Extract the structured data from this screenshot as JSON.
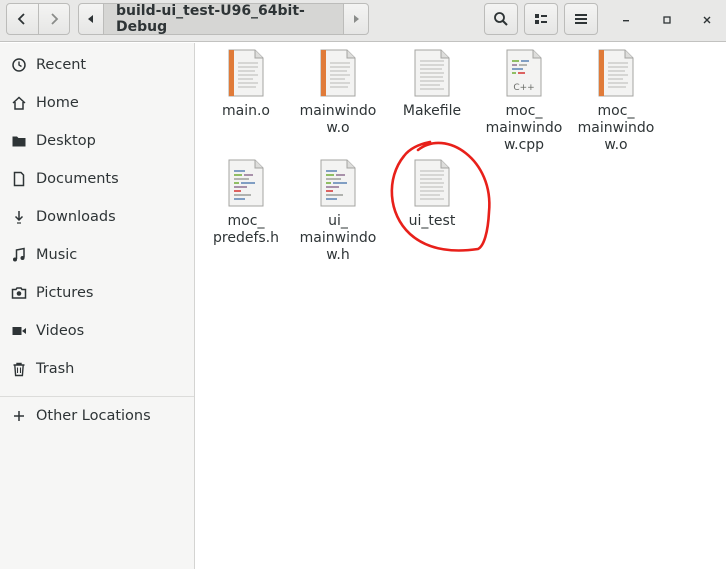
{
  "toolbar": {
    "back_icon": "chevron-left-icon",
    "forward_icon": "chevron-right-icon",
    "path_left_icon": "triangle-left-icon",
    "path_right_icon": "triangle-right-icon",
    "current_folder": "build-ui_test-U96_64bit-Debug",
    "search_icon": "search-icon",
    "view_icon": "view-options-icon",
    "menu_icon": "hamburger-menu-icon",
    "minimize_icon": "minimize-icon",
    "maximize_icon": "maximize-icon",
    "close_icon": "close-icon"
  },
  "sidebar": {
    "items": [
      {
        "label": "Recent",
        "icon": "clock-icon"
      },
      {
        "label": "Home",
        "icon": "home-icon"
      },
      {
        "label": "Desktop",
        "icon": "folder-icon"
      },
      {
        "label": "Documents",
        "icon": "document-icon"
      },
      {
        "label": "Downloads",
        "icon": "download-icon"
      },
      {
        "label": "Music",
        "icon": "music-icon"
      },
      {
        "label": "Pictures",
        "icon": "camera-icon"
      },
      {
        "label": "Videos",
        "icon": "video-icon"
      },
      {
        "label": "Trash",
        "icon": "trash-icon"
      }
    ],
    "other_locations": {
      "label": "Other Locations",
      "icon": "plus-icon"
    }
  },
  "files": [
    {
      "name": "main.o",
      "type": "object"
    },
    {
      "name": "mainwindow.o",
      "type": "object"
    },
    {
      "name": "Makefile",
      "type": "text"
    },
    {
      "name": "moc_mainwindow.cpp",
      "type": "cpp"
    },
    {
      "name": "moc_mainwindow.o",
      "type": "object"
    },
    {
      "name": "moc_predefs.h",
      "type": "header"
    },
    {
      "name": "ui_mainwindow.h",
      "type": "header"
    },
    {
      "name": "ui_test",
      "type": "executable"
    }
  ],
  "labels": {
    "f0": "main.o",
    "f1a": "mainwindo",
    "f1b": "w.o",
    "f2": "Makefile",
    "f3a": "moc_",
    "f3b": "mainwindo",
    "f3c": "w.cpp",
    "f4a": "moc_",
    "f4b": "mainwindo",
    "f4c": "w.o",
    "f5a": "moc_",
    "f5b": "predefs.h",
    "f6a": "ui_",
    "f6b": "mainwindo",
    "f6c": "w.h",
    "f7": "ui_test"
  },
  "colors": {
    "annotation": "#e8201a",
    "object_stripe": "#e07b39",
    "header_bar": "#e8e8e7",
    "sidebar_bg": "#f6f6f5"
  }
}
